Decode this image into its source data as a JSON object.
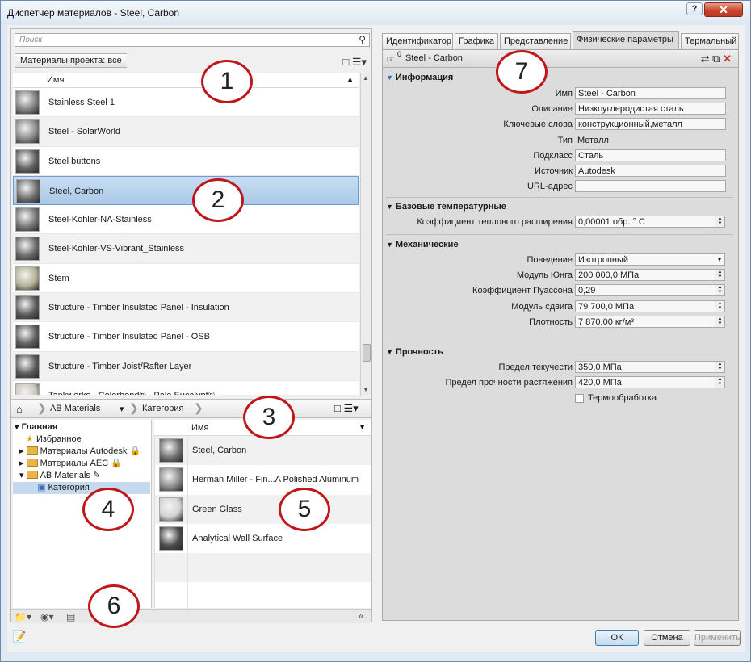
{
  "window": {
    "title": "Диспетчер материалов - Steel, Carbon",
    "help": "?",
    "close": "✕"
  },
  "browser": {
    "search_placeholder": "Поиск",
    "filter": "Материалы проекта: все",
    "column_name": "Имя",
    "materials": [
      {
        "label": "Stainless Steel 1",
        "swatch": "#7f7f7f"
      },
      {
        "label": "Steel - SolarWorld",
        "swatch": "#8a8a8a"
      },
      {
        "label": "Steel buttons",
        "swatch": "#5f5f5f"
      },
      {
        "label": "Steel, Carbon",
        "swatch": "#6e6e6e"
      },
      {
        "label": "Steel-Kohler-NA-Stainless",
        "swatch": "#757575"
      },
      {
        "label": "Steel-Kohler-VS-Vibrant_Stainless",
        "swatch": "#6a6a6a"
      },
      {
        "label": "Stem",
        "swatch": "#b5b298"
      },
      {
        "label": "Structure - Timber Insulated Panel - Insulation",
        "swatch": "#5a5a5a"
      },
      {
        "label": "Structure - Timber Insulated Panel - OSB",
        "swatch": "#5e5e5e"
      },
      {
        "label": "Structure - Timber Joist/Rafter Layer",
        "swatch": "#5a5a5a"
      },
      {
        "label": "Tankworks - Colorbond® - Pale Eucalypt®",
        "swatch": "#c9c6bc"
      }
    ],
    "selected_index": 3
  },
  "library": {
    "breadcrumb_lib": "AB Materials",
    "breadcrumb_cat": "Категория",
    "tree": {
      "root": "Главная",
      "favorites": "Избранное",
      "autodesk": "Материалы Autodesk",
      "aec": "Материалы AEC",
      "ab": "AB Materials",
      "category": "Категория"
    },
    "column_name": "Имя",
    "items": [
      {
        "label": "Steel, Carbon",
        "swatch": "#6e6e6e"
      },
      {
        "label": "Herman Miller - Fin...A Polished Aluminum",
        "swatch": "#8c8c8c"
      },
      {
        "label": "Green Glass",
        "swatch": "#d2d2d2"
      },
      {
        "label": "Analytical Wall Surface",
        "swatch": "#4a4a4a"
      }
    ]
  },
  "editor": {
    "tabs": [
      "Идентификатор",
      "Графика",
      "Представление",
      "Физические параметры",
      "Термальный"
    ],
    "active_tab": 3,
    "asset_name": "Steel - Carbon",
    "asset_count": "0",
    "info": {
      "section": "Информация",
      "name_label": "Имя",
      "name_value": "Steel - Carbon",
      "desc_label": "Описание",
      "desc_value": "Низкоуглеродистая сталь",
      "keywords_label": "Ключевые слова",
      "keywords_value": "конструкционный,металл",
      "type_label": "Тип",
      "type_value": "Металл",
      "subclass_label": "Подкласс",
      "subclass_value": "Сталь",
      "source_label": "Источник",
      "source_value": "Autodesk",
      "url_label": "URL-адрес",
      "url_value": ""
    },
    "thermal": {
      "section": "Базовые температурные",
      "coef_label": "Коэффициент теплового расширения",
      "coef_value": "0,00001 обр. ° C"
    },
    "mechanical": {
      "section": "Механические",
      "behavior_label": "Поведение",
      "behavior_value": "Изотропный",
      "young_label": "Модуль Юнга",
      "young_value": "200 000,0 МПа",
      "poisson_label": "Коэффициент Пуассона",
      "poisson_value": "0,29",
      "shear_label": "Модуль сдвига",
      "shear_value": "79 700,0 МПа",
      "density_label": "Плотность",
      "density_value": "7 870,00 кг/м³"
    },
    "strength": {
      "section": "Прочность",
      "yield_label": "Предел текучести",
      "yield_value": "350,0 МПа",
      "tensile_label": "Предел прочности растяжения",
      "tensile_value": "420,0 МПа",
      "heat_label": "Термообработка"
    }
  },
  "footer": {
    "ok": "ОК",
    "cancel": "Отмена",
    "apply": "Применить"
  },
  "callouts": [
    "1",
    "2",
    "3",
    "4",
    "5",
    "6",
    "7"
  ]
}
